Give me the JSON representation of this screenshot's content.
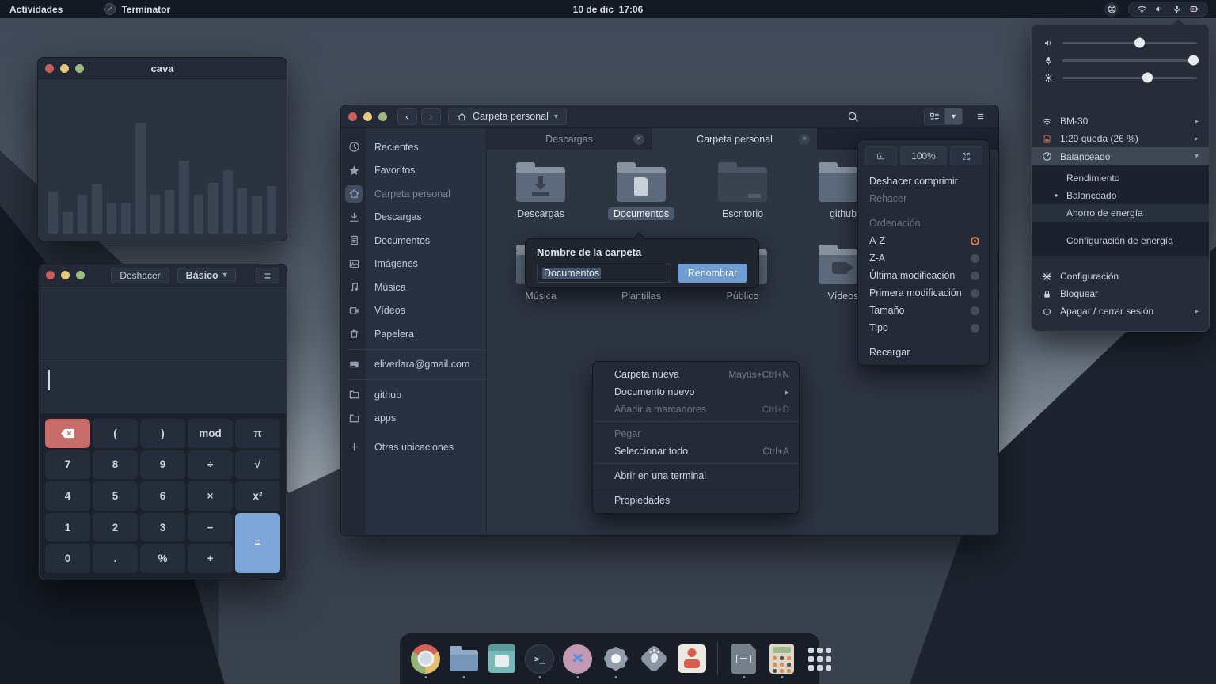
{
  "colors": {
    "accent_blue": "#6f9cd1",
    "selection": "#4d5a6e",
    "danger_red": "#c96b6b",
    "equals_blue": "#7ea6d8",
    "radio_active": "#d87950",
    "traffic_red": "#c6605f",
    "traffic_yellow": "#e7c87e",
    "traffic_green": "#9dbb80"
  },
  "icons": {
    "back": "‹",
    "forward": "›",
    "caret_down": "▾",
    "chevron_right": "▸",
    "close": "×",
    "bullet": "•",
    "hamburger": "≡"
  },
  "topbar": {
    "activities": "Actividades",
    "app": "Terminator",
    "clock": "10 de dic  17:06",
    "tray_icons": [
      "globe-icon",
      "wifi-icon",
      "volume-icon",
      "microphone-icon",
      "battery-icon"
    ]
  },
  "cava": {
    "title": "cava",
    "bars": [
      27,
      14,
      25,
      32,
      20,
      20,
      72,
      25,
      28,
      47,
      25,
      33,
      41,
      29,
      24,
      31
    ]
  },
  "calculator": {
    "undo": "Deshacer",
    "mode": "Básico",
    "keys": {
      "backspace": "⌫",
      "open_paren": "(",
      "close_paren": ")",
      "mod": "mod",
      "pi": "π",
      "seven": "7",
      "eight": "8",
      "nine": "9",
      "divide": "÷",
      "sqrt": "√",
      "four": "4",
      "five": "5",
      "six": "6",
      "multiply": "×",
      "square": "x²",
      "one": "1",
      "two": "2",
      "three": "3",
      "minus": "−",
      "equals": "=",
      "zero": "0",
      "dot": ".",
      "percent": "%",
      "plus": "+"
    }
  },
  "files": {
    "path": "Carpeta personal",
    "tabs": [
      {
        "label": "Descargas",
        "active": false
      },
      {
        "label": "Carpeta personal",
        "active": true
      }
    ],
    "sidebar": [
      {
        "icon": "clock-icon",
        "label": "Recientes"
      },
      {
        "icon": "star-icon",
        "label": "Favoritos"
      },
      {
        "icon": "home-icon",
        "label": "Carpeta personal",
        "selected": true
      },
      {
        "icon": "download-icon",
        "label": "Descargas"
      },
      {
        "icon": "document-icon",
        "label": "Documentos"
      },
      {
        "icon": "image-icon",
        "label": "Imágenes"
      },
      {
        "icon": "music-icon",
        "label": "Música"
      },
      {
        "icon": "video-icon",
        "label": "Vídeos"
      },
      {
        "icon": "trash-icon",
        "label": "Papelera"
      },
      {
        "icon": "drive-icon",
        "label": "eliverlara@gmail.com"
      },
      {
        "icon": "folder-icon",
        "label": "github"
      },
      {
        "icon": "folder-icon",
        "label": "apps"
      },
      {
        "icon": "plus-icon",
        "label": "Otras ubicaciones"
      }
    ],
    "grid": [
      {
        "label": "Descargas",
        "glyph": "download"
      },
      {
        "label": "Documentos",
        "glyph": "document",
        "selected": true
      },
      {
        "label": "Escritorio",
        "glyph": "desktop"
      },
      {
        "label": "github",
        "glyph": "none"
      },
      {
        "label": "Música",
        "glyph": "none"
      },
      {
        "label": "Plantillas",
        "glyph": "none"
      },
      {
        "label": "Público",
        "glyph": "none"
      },
      {
        "label": "Vídeos",
        "glyph": "camera"
      }
    ],
    "rename": {
      "title": "Nombre de la carpeta",
      "value": "Documentos",
      "button": "Renombrar"
    },
    "context_menu": [
      {
        "label": "Carpeta nueva",
        "shortcut": "Mayús+Ctrl+N",
        "enabled": true
      },
      {
        "label": "Documento nuevo",
        "submenu": true,
        "enabled": true
      },
      {
        "label": "Añadir a marcadores",
        "shortcut": "Ctrl+D",
        "enabled": false
      },
      {
        "label": "Pegar",
        "enabled": false
      },
      {
        "label": "Seleccionar todo",
        "shortcut": "Ctrl+A",
        "enabled": true
      },
      {
        "label": "Abrir en una terminal",
        "enabled": true
      },
      {
        "label": "Propiedades",
        "enabled": true
      }
    ],
    "view_menu": {
      "zoom_level": "100%",
      "undo": "Deshacer comprimir",
      "redo": "Rehacer",
      "sort_header": "Ordenación",
      "sort_options": [
        "A-Z",
        "Z-A",
        "Última modificación",
        "Primera modificación",
        "Tamaño",
        "Tipo"
      ],
      "selected_sort": "A-Z",
      "reload": "Recargar"
    }
  },
  "system_menu": {
    "sliders": [
      {
        "name": "volume",
        "value": 57
      },
      {
        "name": "microphone",
        "value": 97
      },
      {
        "name": "brightness",
        "value": 63
      }
    ],
    "wifi": {
      "label": "BM-30"
    },
    "battery": {
      "label": "1:29 queda (26 %)"
    },
    "power_profile": {
      "current": "Balanceado",
      "options": [
        "Rendimiento",
        "Balanceado",
        "Ahorro de energía"
      ],
      "selected": "Balanceado",
      "settings_link": "Configuración de energía"
    },
    "settings": "Configuración",
    "lock": "Bloquear",
    "power": "Apagar / cerrar sesión"
  },
  "dock": {
    "apps": [
      "chrome",
      "files",
      "text-editor",
      "terminal",
      "code-editor",
      "settings",
      "tweaks",
      "media-app",
      "archive-manager",
      "calculator",
      "show-applications"
    ]
  }
}
